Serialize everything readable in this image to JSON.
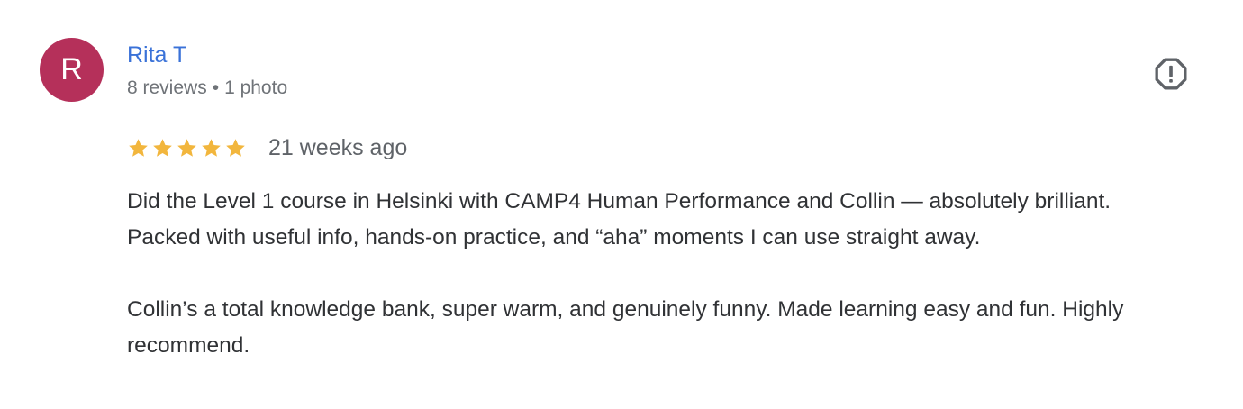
{
  "review": {
    "avatar_initial": "R",
    "author": {
      "name": "Rita T",
      "reviews_count": "8 reviews",
      "separator": "•",
      "photos_count": "1 photo"
    },
    "rating": {
      "stars": 5,
      "max_stars": 5,
      "date": "21 weeks ago"
    },
    "icons": {
      "report": "report-flag-icon",
      "star": "star-icon"
    },
    "colors": {
      "avatar": "#b5305a",
      "author_name": "#3a72d8",
      "star": "#f2b63d"
    },
    "text": {
      "line1": "Did the Level 1 course in Helsinki with CAMP4 Human Performance and Collin — absolutely brilliant.",
      "line2": "Packed with useful info, hands-on practice, and “aha” moments I can use straight away.",
      "line3": "Collin’s a total knowledge bank, super warm, and genuinely funny. Made learning easy and fun. Highly recommend."
    }
  }
}
